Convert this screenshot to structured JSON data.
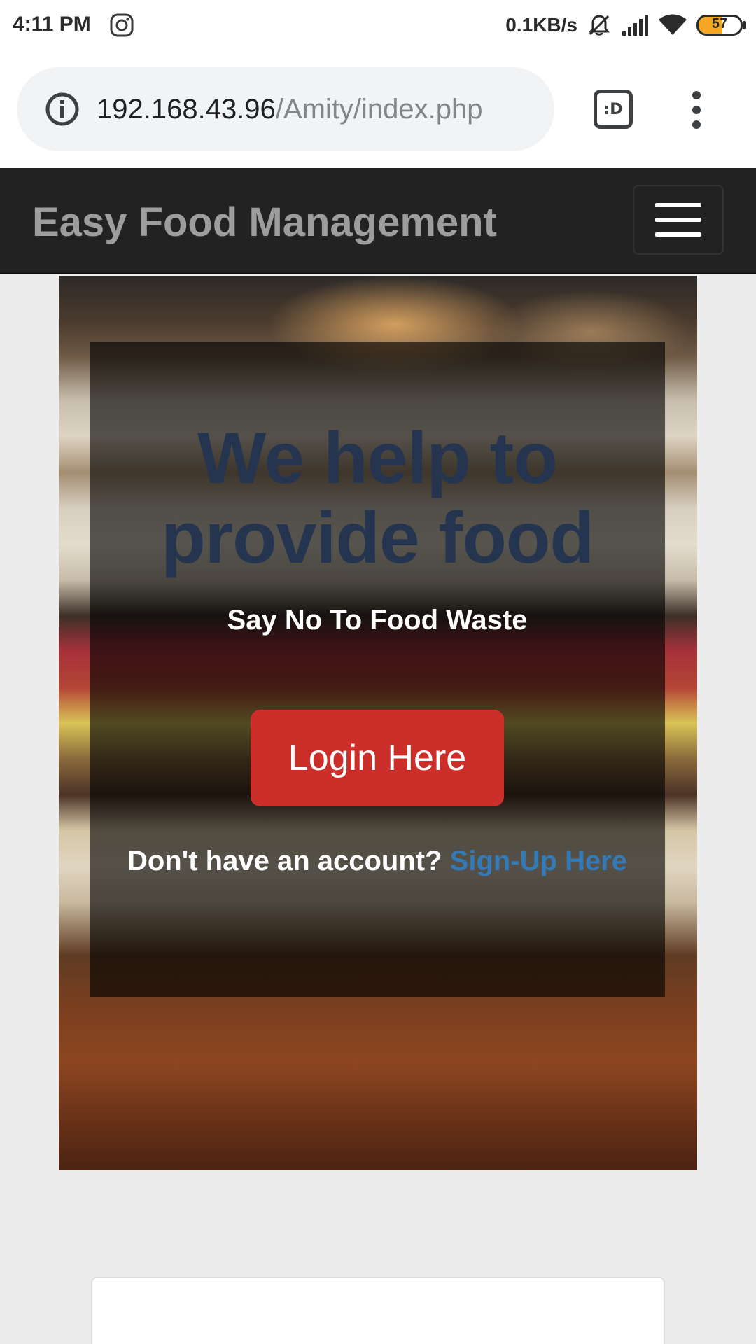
{
  "status_bar": {
    "time": "4:11 PM",
    "net_speed": "0.1KB/s",
    "battery_level": "57",
    "battery_fraction": 0.57,
    "icons": [
      "instagram-icon",
      "bell-muted-icon",
      "signal-icon",
      "wifi-icon",
      "battery-icon"
    ]
  },
  "browser": {
    "url_host": "192.168.43.96",
    "url_path": "/Amity/index.php",
    "tab_button_label": ":D",
    "icons": [
      "info-icon",
      "tabs-icon",
      "more-vert-icon"
    ]
  },
  "navbar": {
    "brand": "Easy Food Management",
    "icons": [
      "hamburger-menu-icon"
    ]
  },
  "hero": {
    "title": "We help to provide food",
    "subtitle": "Say No To Food Waste",
    "login_label": "Login Here",
    "signup_prompt": "Don't have an account?",
    "signup_link": "Sign-Up Here"
  },
  "colors": {
    "navbar_bg": "#222222",
    "brand_text": "#9d9d9d",
    "login_button": "#cc2f2a",
    "link": "#337ab7",
    "title_text": "#25354f",
    "battery_fill": "#f5a623"
  }
}
